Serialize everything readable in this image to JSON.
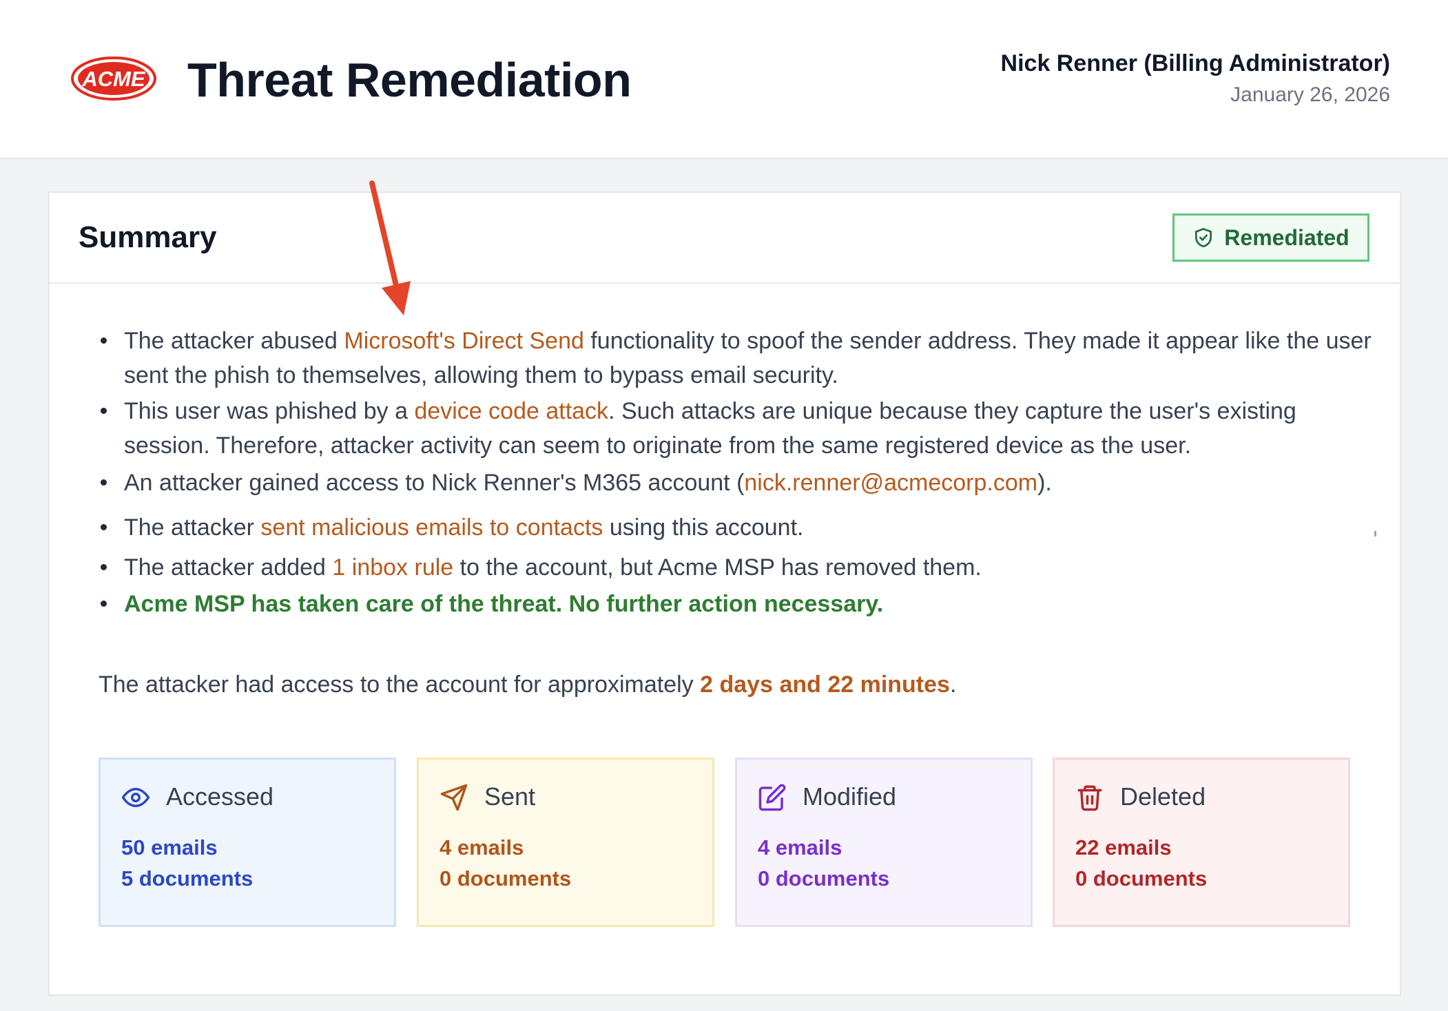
{
  "header": {
    "logo_text": "ACME",
    "title": "Threat Remediation",
    "user": "Nick Renner (Billing Administrator)",
    "date": "January 26, 2026"
  },
  "summary": {
    "title": "Summary",
    "status_badge": "Remediated",
    "bullets": [
      {
        "pre": "The attacker abused ",
        "link": "Microsoft's Direct Send",
        "post": " functionality to spoof the sender address. They made it appear like the user sent the phish to themselves, allowing them to bypass email security."
      },
      {
        "pre": "This user was phished by a ",
        "link": "device code attack",
        "post": ". Such attacks are unique because they capture the user's existing session. Therefore, attacker activity can seem to originate from the same registered device as the user."
      },
      {
        "pre": "An attacker gained access to Nick Renner's M365 account (",
        "link": "nick.renner@acmecorp.com",
        "post": ")."
      },
      {
        "pre": "The attacker ",
        "link": "sent malicious emails to contacts",
        "post": " using this account."
      },
      {
        "pre": "The attacker added ",
        "link": "1 inbox rule",
        "post": " to the account, but Acme MSP has removed them."
      },
      {
        "text": "Acme MSP has taken care of the threat. No further action necessary."
      }
    ],
    "duration_pre": "The attacker had access to the account for approximately ",
    "duration_value": "2 days and 22 minutes",
    "duration_post": "."
  },
  "stats": [
    {
      "label": "Accessed",
      "icon": "eye-icon",
      "emails": "50 emails",
      "documents": "5 documents",
      "color": "#2c47c5"
    },
    {
      "label": "Sent",
      "icon": "send-icon",
      "emails": "4 emails",
      "documents": "0 documents",
      "color": "#b1551a"
    },
    {
      "label": "Modified",
      "icon": "edit-icon",
      "emails": "4 emails",
      "documents": "0 documents",
      "color": "#7a2ed0"
    },
    {
      "label": "Deleted",
      "icon": "trash-icon",
      "emails": "22 emails",
      "documents": "0 documents",
      "color": "#b32626"
    }
  ],
  "colors": {
    "accent_link": "#b55a1d",
    "success": "#2e7d32",
    "annotation_arrow": "#e5432a"
  }
}
